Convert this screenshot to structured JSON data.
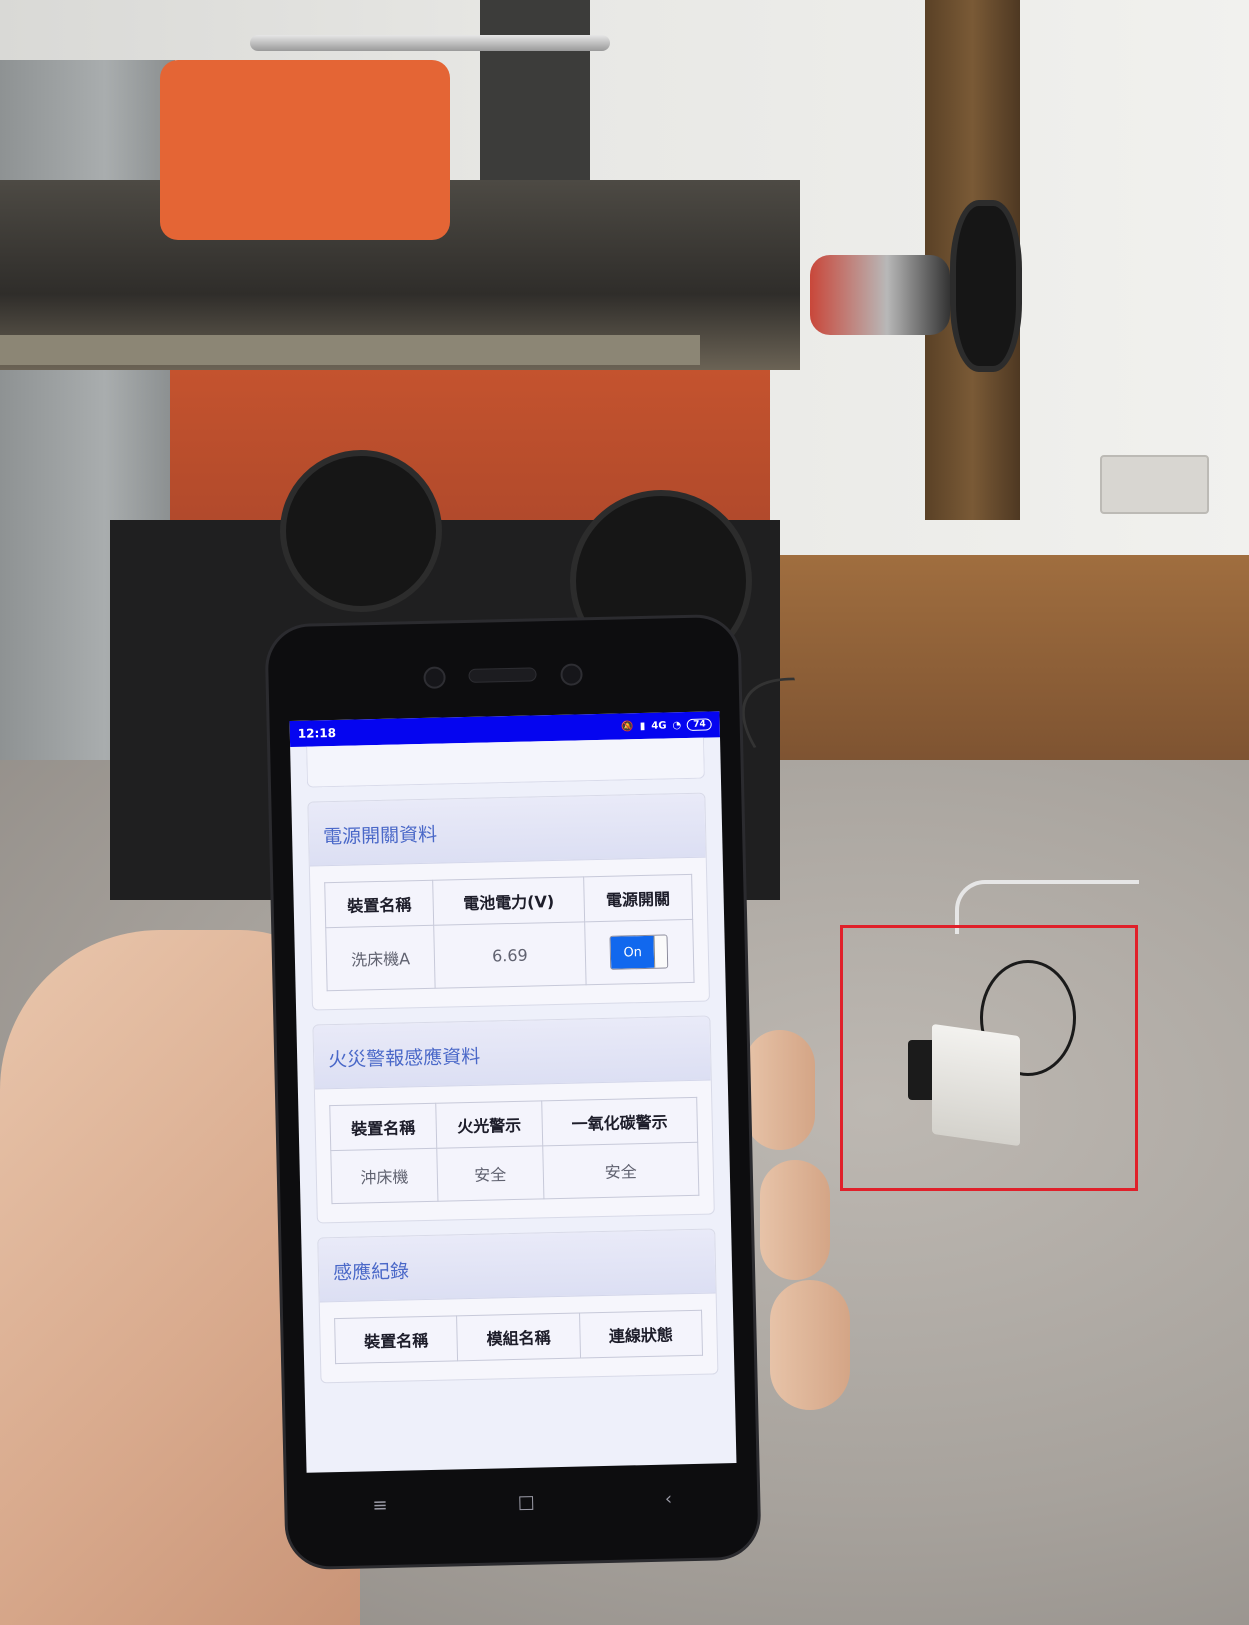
{
  "phone": {
    "status_bar": {
      "time": "12:18",
      "network": "4G",
      "battery": "74"
    },
    "sections": [
      {
        "title": "電源開關資料",
        "headers": [
          "裝置名稱",
          "電池電力(V)",
          "電源開關"
        ],
        "row": {
          "device": "洗床機A",
          "battery_voltage": "6.69",
          "switch_label": "On"
        }
      },
      {
        "title": "火災警報感應資料",
        "headers": [
          "裝置名稱",
          "火光警示",
          "一氧化碳警示"
        ],
        "row": {
          "device": "沖床機",
          "flame": "安全",
          "co": "安全"
        }
      },
      {
        "title": "感應紀錄",
        "headers": [
          "裝置名稱",
          "模組名稱",
          "連線狀態"
        ]
      }
    ],
    "nav": {
      "menu": "≡",
      "home": "□",
      "back": "‹"
    }
  },
  "colors": {
    "status_bar": "#0505f0",
    "header_text": "#4a68c8",
    "toggle_on": "#1168ee",
    "highlight_box": "#e0202a"
  }
}
